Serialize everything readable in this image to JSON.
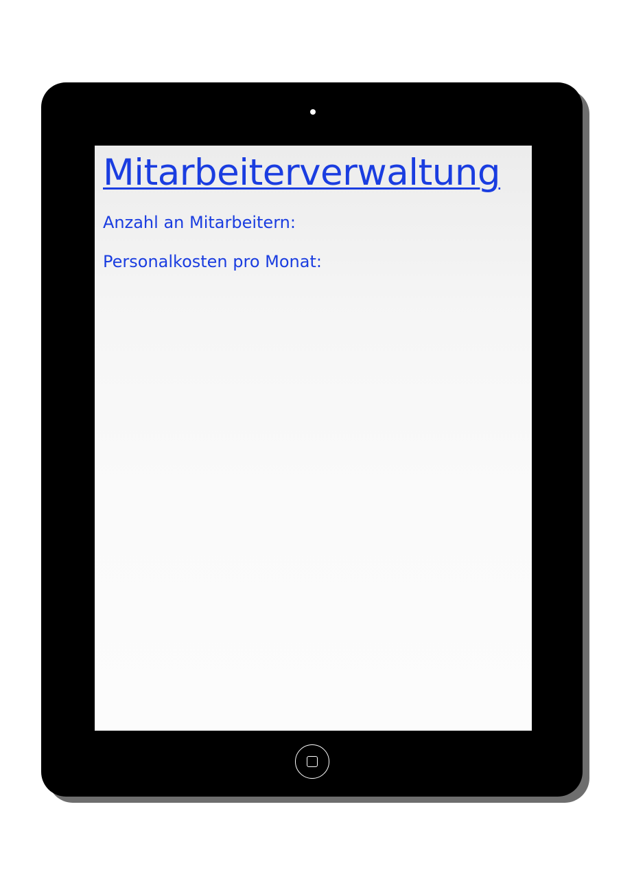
{
  "app": {
    "title": "Mitarbeiterverwaltung"
  },
  "stats": {
    "employees_label": "Anzahl an Mitarbeitern:",
    "costs_label": "Personalkosten pro Monat:"
  },
  "device": {
    "frame_color": "#000000",
    "shadow_color": "#6e6e6e",
    "screen_color": "#f8f8f8",
    "icons": [
      "camera-icon",
      "home-button-icon"
    ]
  },
  "colors": {
    "text_accent": "#1a3de0"
  }
}
